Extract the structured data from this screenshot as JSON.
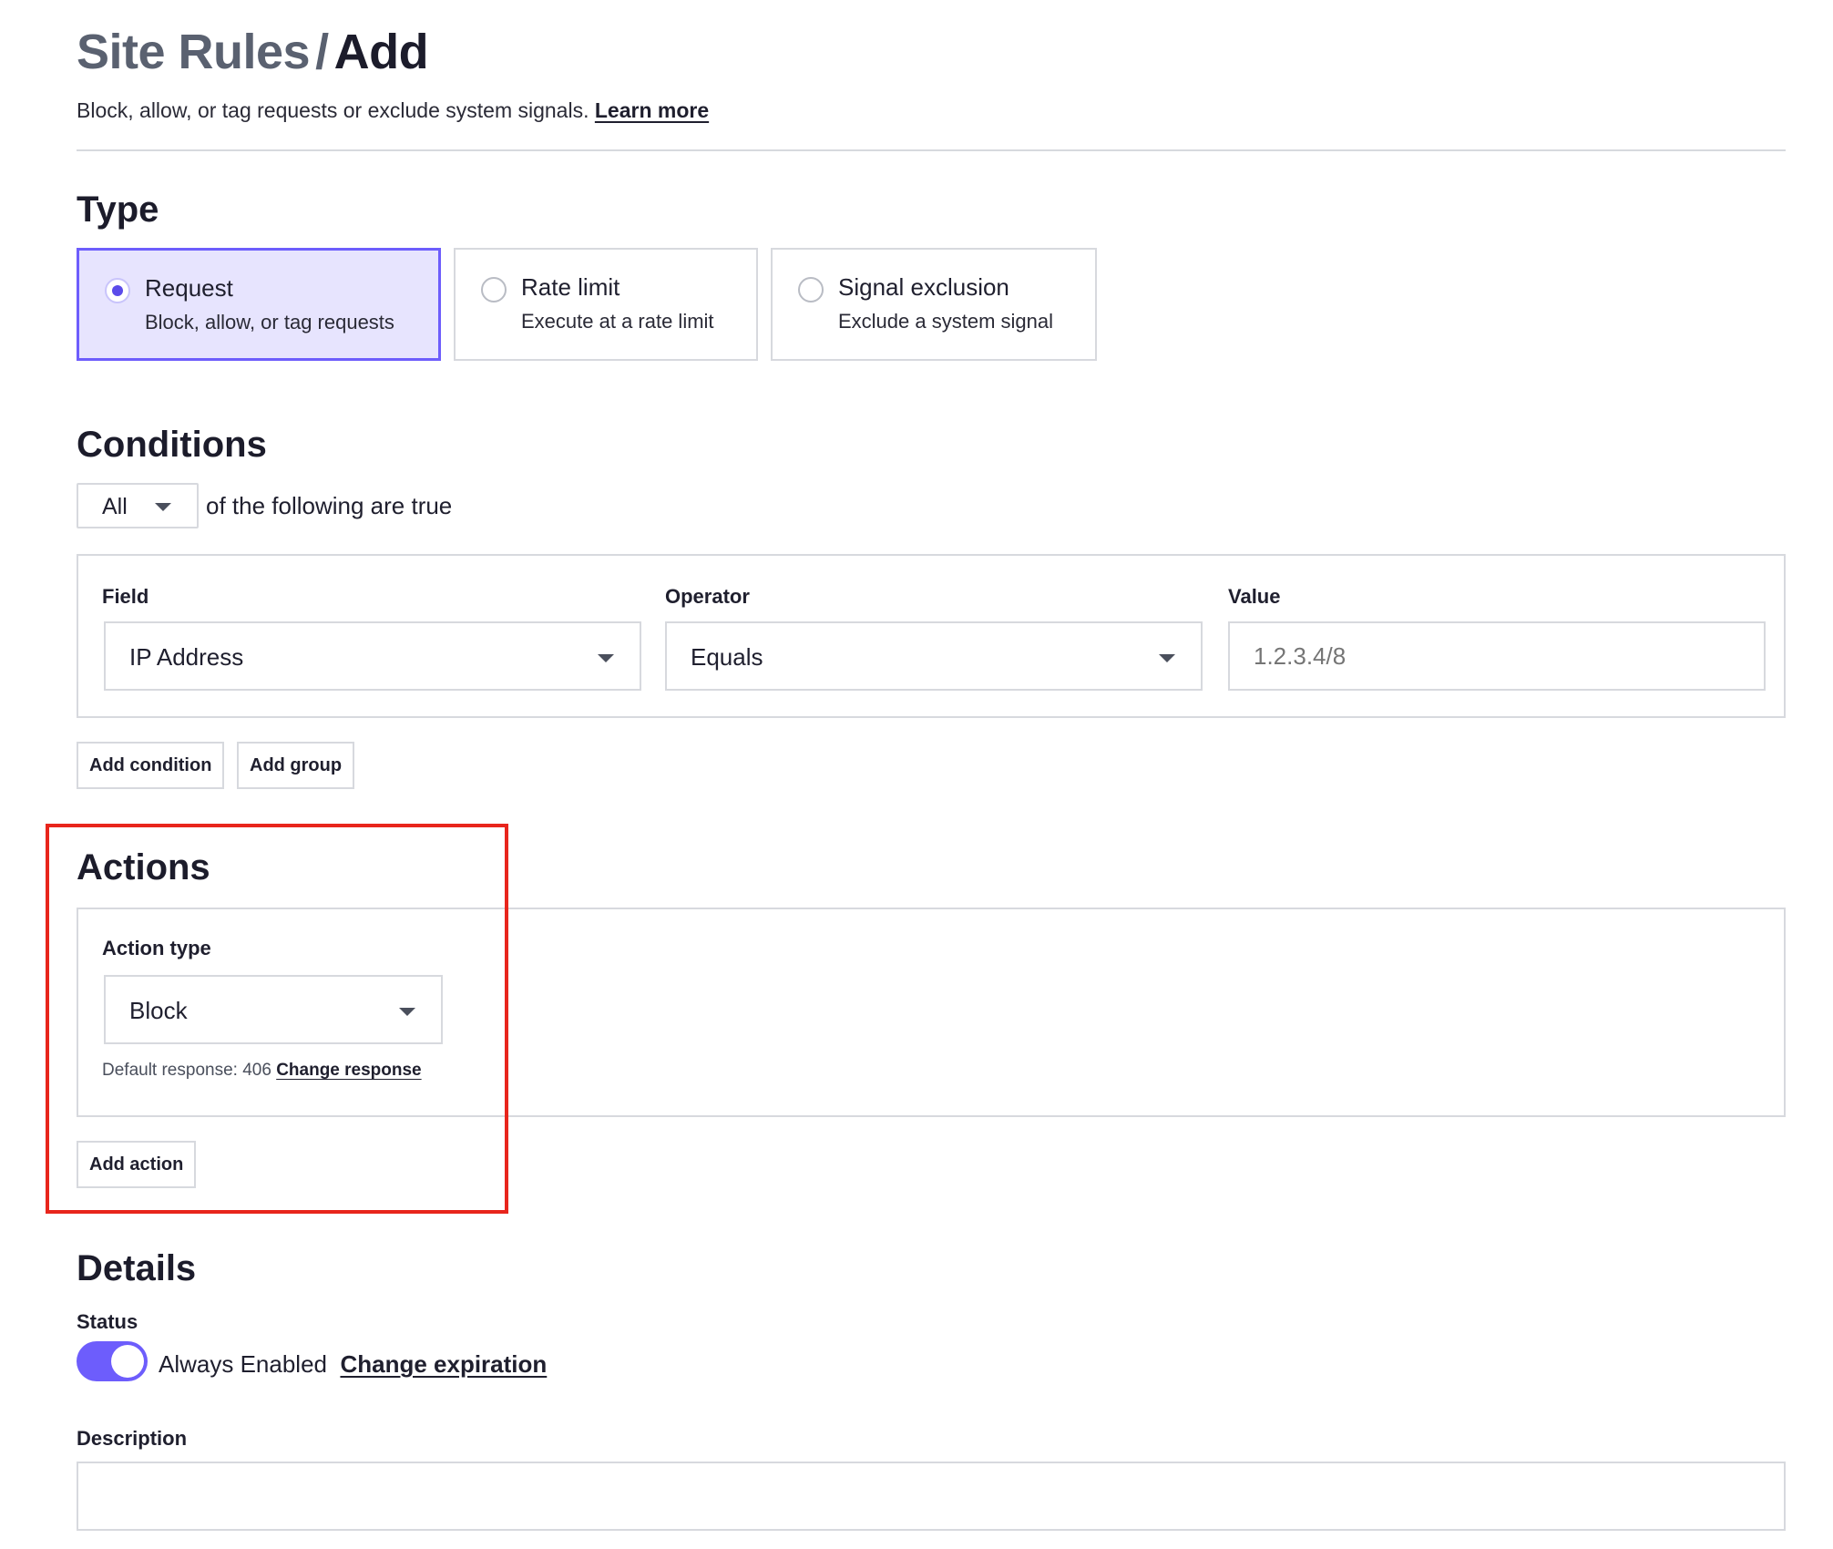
{
  "header": {
    "crumb": "Site Rules",
    "separator": "/",
    "current": "Add",
    "subtitle": "Block, allow, or tag requests or exclude system signals.",
    "learn_more": "Learn more"
  },
  "type_section": {
    "heading": "Type",
    "options": [
      {
        "title": "Request",
        "desc": "Block, allow, or tag requests",
        "selected": true
      },
      {
        "title": "Rate limit",
        "desc": "Execute at a rate limit",
        "selected": false
      },
      {
        "title": "Signal exclusion",
        "desc": "Exclude a system signal",
        "selected": false
      }
    ]
  },
  "conditions": {
    "heading": "Conditions",
    "match_value": "All",
    "match_suffix": "of the following are true",
    "field_label": "Field",
    "field_value": "IP Address",
    "operator_label": "Operator",
    "operator_value": "Equals",
    "value_label": "Value",
    "value_placeholder": "1.2.3.4/8",
    "add_condition": "Add condition",
    "add_group": "Add group"
  },
  "actions": {
    "heading": "Actions",
    "action_type_label": "Action type",
    "action_type_value": "Block",
    "default_response": "Default response: 406",
    "change_response": "Change response",
    "add_action": "Add action"
  },
  "details": {
    "heading": "Details",
    "status_label": "Status",
    "status_enabled": true,
    "status_text": "Always Enabled",
    "change_expiration": "Change expiration",
    "description_label": "Description",
    "description_value": ""
  },
  "colors": {
    "accent": "#6d5dfc",
    "selected_bg": "#e7e4fe",
    "highlight_border": "#e8251c",
    "border": "#d7d9de"
  }
}
